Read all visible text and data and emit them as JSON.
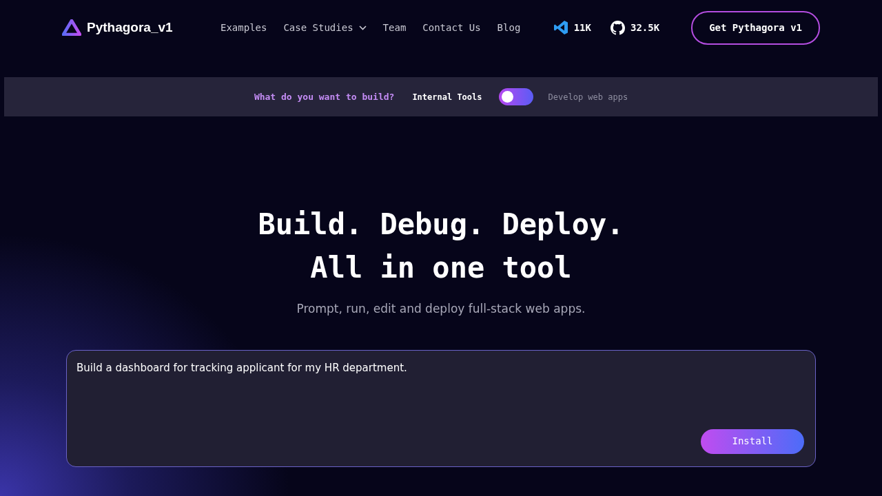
{
  "brand": {
    "name": "Pythagora_v1"
  },
  "nav": [
    {
      "label": "Examples",
      "dropdown": false
    },
    {
      "label": "Case Studies",
      "dropdown": true
    },
    {
      "label": "Team",
      "dropdown": false
    },
    {
      "label": "Contact Us",
      "dropdown": false
    },
    {
      "label": "Blog",
      "dropdown": false
    }
  ],
  "stats": [
    {
      "kind": "vscode",
      "count": "11K"
    },
    {
      "kind": "github",
      "count": "32.5K"
    }
  ],
  "cta_button": "Get Pythagora v1",
  "build_bar": {
    "question": "What do you want to build?",
    "left_option": "Internal Tools",
    "right_option": "Develop web apps",
    "toggle_on": false
  },
  "hero": {
    "title_lines": [
      "Build. Debug. Deploy.",
      "All in one tool"
    ],
    "subtitle": "Prompt, run, edit and deploy full-stack web apps."
  },
  "prompt": {
    "value": "Build a dashboard for tracking applicant for my HR department.",
    "button": "Install"
  }
}
